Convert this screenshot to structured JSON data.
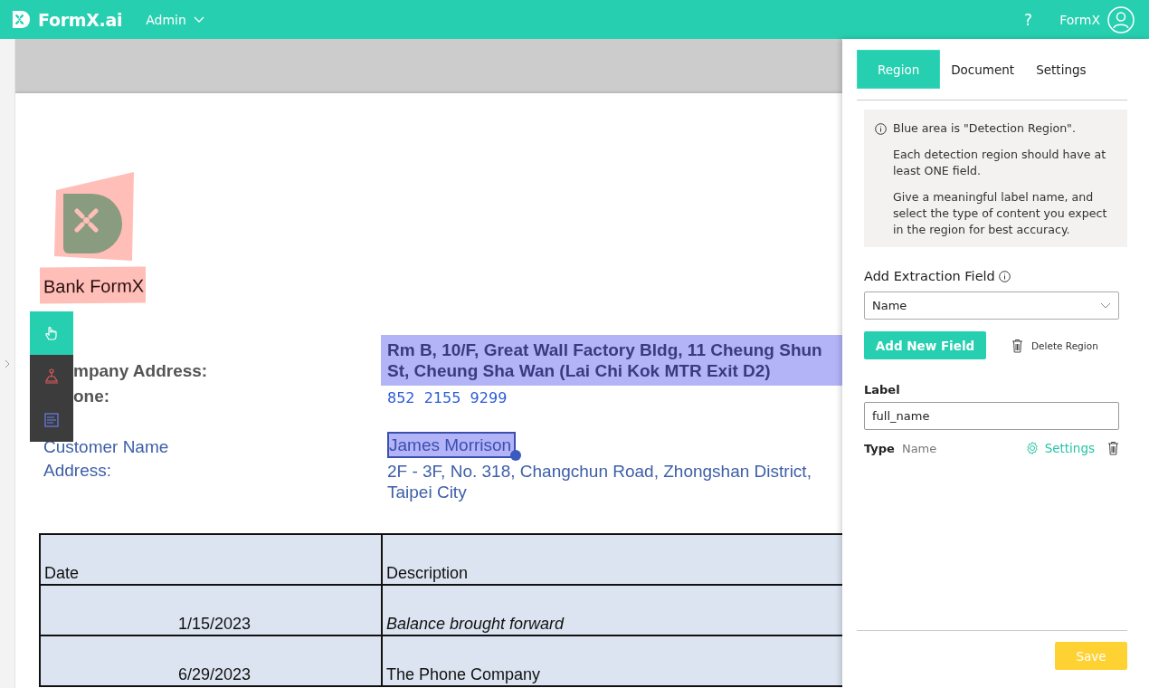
{
  "header": {
    "brand": "FormX.ai",
    "menu": "Admin",
    "help": "?",
    "user": "FormX"
  },
  "document": {
    "logo_text": "Bank FormX",
    "fields": [
      {
        "kind": "company",
        "label": "mpany Address:",
        "lines": [
          "Rm B, 10/F, Great Wall Factory Bldg, 11 Cheung Shun",
          "St, Cheung Sha Wan (Lai Chi Kok MTR Exit D2)"
        ],
        "region": true,
        "selected": false
      },
      {
        "kind": "company",
        "label": "one:",
        "lines": [
          "852  2155  9299"
        ],
        "region": false,
        "selected": false
      },
      {
        "kind": "customer",
        "label": "Customer Name",
        "lines": [
          "James Morrison"
        ],
        "region": false,
        "selected": true
      },
      {
        "kind": "customer",
        "label": "Address:",
        "lines": [
          "2F - 3F, No. 318, Changchun Road, Zhongshan District,",
          "Taipei City"
        ],
        "region": false,
        "selected": false
      }
    ],
    "table": {
      "columns": [
        "Date",
        "Description"
      ],
      "rows": [
        {
          "date": "1/15/2023",
          "description": "Balance brought forward",
          "italic": true
        },
        {
          "date": "6/29/2023",
          "description": "The Phone Company",
          "italic": false
        }
      ]
    }
  },
  "tools": [
    {
      "kind": "hand",
      "selected": true
    },
    {
      "kind": "region",
      "selected": false
    },
    {
      "kind": "text",
      "selected": false
    }
  ],
  "panel": {
    "tabs": [
      {
        "label": "Region",
        "selected": true
      },
      {
        "label": "Document",
        "selected": false
      },
      {
        "label": "Settings",
        "selected": false
      }
    ],
    "info": [
      "Blue area is \"Detection Region\".",
      "Each detection region should have at least ONE field.",
      "Give a meaningful label name, and select the type of content you expect in the region for best accuracy."
    ],
    "section_title": "Add Extraction Field",
    "field_select": "Name",
    "add_button": "Add New Field",
    "delete_button": "Delete Region",
    "label_title": "Label",
    "label_value": "full_name",
    "type_title": "Type",
    "type_value": "Name",
    "settings_link": "Settings",
    "save_button": "Save"
  }
}
